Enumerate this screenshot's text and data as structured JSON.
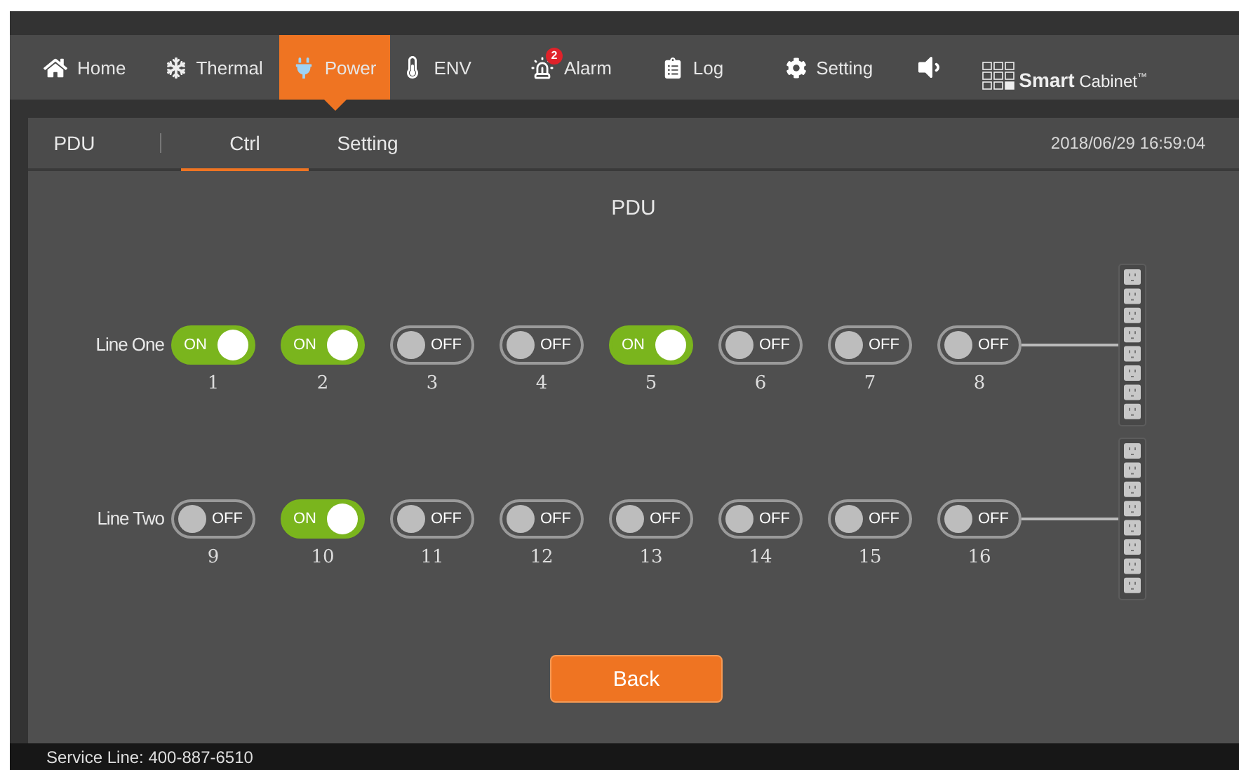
{
  "nav": {
    "items": [
      {
        "kind": "home",
        "label": "Home",
        "selected": false
      },
      {
        "kind": "thermal",
        "label": "Thermal",
        "selected": false
      },
      {
        "kind": "power",
        "label": "Power",
        "selected": true
      },
      {
        "kind": "env",
        "label": "ENV",
        "selected": false
      },
      {
        "kind": "alarm",
        "label": "Alarm",
        "selected": false,
        "badge": "2"
      },
      {
        "kind": "log",
        "label": "Log",
        "selected": false
      },
      {
        "kind": "setting",
        "label": "Setting",
        "selected": false
      }
    ],
    "logo": "**Smart** Cabinet$^{™}$"
  },
  "subtabs": [
    {
      "label": "PDU",
      "selected": false
    },
    {
      "label": "Ctrl",
      "selected": true
    },
    {
      "label": "Setting",
      "selected": false
    }
  ],
  "datetime": "2018/06/29 16:59:04",
  "title": "PDU",
  "lines": [
    {
      "name": "Line One",
      "outlets": [
        {
          "number": "1",
          "label": "ON",
          "on": true
        },
        {
          "number": "2",
          "label": "ON",
          "on": true
        },
        {
          "number": "3",
          "label": "OFF",
          "on": false
        },
        {
          "number": "4",
          "label": "OFF",
          "on": false
        },
        {
          "number": "5",
          "label": "ON",
          "on": true
        },
        {
          "number": "6",
          "label": "OFF",
          "on": false
        },
        {
          "number": "7",
          "label": "OFF",
          "on": false
        },
        {
          "number": "8",
          "label": "OFF",
          "on": false
        }
      ]
    },
    {
      "name": "Line Two",
      "outlets": [
        {
          "number": "9",
          "label": "OFF",
          "on": false
        },
        {
          "number": "10",
          "label": "ON",
          "on": true
        },
        {
          "number": "11",
          "label": "OFF",
          "on": false
        },
        {
          "number": "12",
          "label": "OFF",
          "on": false
        },
        {
          "number": "13",
          "label": "OFF",
          "on": false
        },
        {
          "number": "14",
          "label": "OFF",
          "on": false
        },
        {
          "number": "15",
          "label": "OFF",
          "on": false
        },
        {
          "number": "16",
          "label": "OFF",
          "on": false
        }
      ]
    }
  ],
  "back_button": "Back",
  "service_line": "Service Line: 400-887-6510"
}
